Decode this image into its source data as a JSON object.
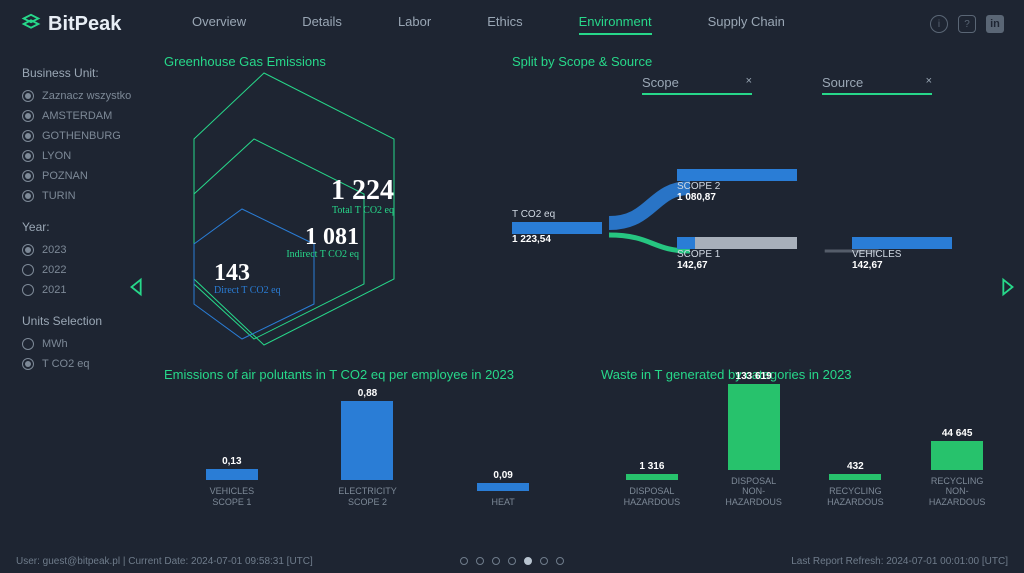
{
  "brand": "BitPeak",
  "tabs": [
    "Overview",
    "Details",
    "Labor",
    "Ethics",
    "Environment",
    "Supply Chain"
  ],
  "active_tab": "Environment",
  "sidebar": {
    "bu_head": "Business Unit:",
    "bu_items": [
      "Zaznacz wszystko",
      "AMSTERDAM",
      "GOTHENBURG",
      "LYON",
      "POZNAN",
      "TURIN"
    ],
    "year_head": "Year:",
    "year_items": [
      "2023",
      "2022",
      "2021"
    ],
    "units_head": "Units Selection",
    "units_items": [
      "MWh",
      "T CO2 eq"
    ]
  },
  "ghg": {
    "title": "Greenhouse Gas Emissions",
    "total_val": "1 224",
    "total_lbl": "Total T CO2 eq",
    "indirect_val": "1 081",
    "indirect_lbl": "Indirect T CO2 eq",
    "direct_val": "143",
    "direct_lbl": "Direct T CO2 eq"
  },
  "split": {
    "title": "Split by Scope & Source",
    "scope_lbl": "Scope",
    "source_lbl": "Source",
    "root_lbl": "T CO2 eq",
    "root_val": "1 223,54",
    "scope2_lbl": "SCOPE 2",
    "scope2_val": "1 080,87",
    "scope1_lbl": "SCOPE 1",
    "scope1_val": "142,67",
    "veh_lbl": "VEHICLES",
    "veh_val": "142,67"
  },
  "emissions_chart": {
    "title": "Emissions of air polutants in T CO2 eq per employee in 2023"
  },
  "waste_chart": {
    "title": "Waste in T generated by categories in 2023"
  },
  "footer": {
    "left": "User: guest@bitpeak.pl | Current Date: 2024-07-01 09:58:31 [UTC]",
    "right": "Last Report Refresh: 2024-07-01 00:01:00 [UTC]"
  },
  "chart_data": [
    {
      "type": "bar",
      "title": "Emissions of air polutants in T CO2 eq per employee in 2023",
      "categories": [
        "VEHICLES SCOPE 1",
        "ELECTRICITY SCOPE 2",
        "HEAT"
      ],
      "values": [
        0.13,
        0.88,
        0.09
      ],
      "color": "blue",
      "ylim": [
        0,
        1
      ]
    },
    {
      "type": "bar",
      "title": "Waste in T generated by categories in 2023",
      "categories": [
        "DISPOSAL HAZARDOUS",
        "DISPOSAL NON-HAZARDOUS",
        "RECYCLING HAZARDOUS",
        "RECYCLING NON-HAZARDOUS"
      ],
      "values": [
        1316,
        133619,
        432,
        44645
      ],
      "color": "green",
      "ylim": [
        0,
        140000
      ]
    },
    {
      "type": "sankey",
      "title": "Split by Scope & Source",
      "root": {
        "label": "T CO2 eq",
        "value": 1223.54
      },
      "nodes": [
        {
          "label": "SCOPE 2",
          "value": 1080.87
        },
        {
          "label": "SCOPE 1",
          "value": 142.67,
          "children": [
            {
              "label": "VEHICLES",
              "value": 142.67
            }
          ]
        }
      ]
    },
    {
      "type": "nested",
      "title": "Greenhouse Gas Emissions",
      "items": [
        {
          "label": "Total T CO2 eq",
          "value": 1224
        },
        {
          "label": "Indirect T CO2 eq",
          "value": 1081
        },
        {
          "label": "Direct T CO2 eq",
          "value": 143
        }
      ]
    }
  ]
}
